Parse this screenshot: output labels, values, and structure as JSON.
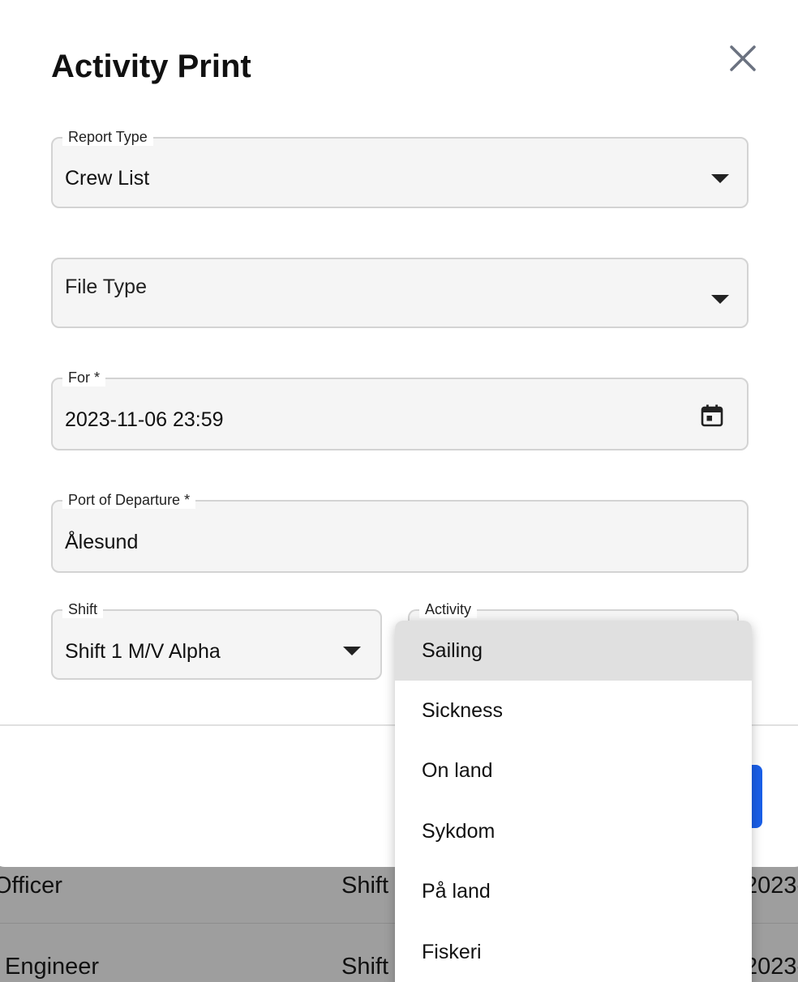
{
  "dialog": {
    "title": "Activity Print",
    "close_icon": "close-icon"
  },
  "form": {
    "report_type": {
      "label": "Report Type",
      "value": "Crew List"
    },
    "file_type": {
      "placeholder": "File Type"
    },
    "for": {
      "label": "For *",
      "value": "2023-11-06 23:59",
      "icon": "calendar-icon"
    },
    "port_of_departure": {
      "label": "Port of Departure *",
      "value": "Ålesund"
    },
    "shift": {
      "label": "Shift",
      "value": "Shift 1 M/V Alpha"
    },
    "activity": {
      "label": "Activity"
    }
  },
  "activity_menu": {
    "items": [
      {
        "label": "Sailing",
        "selected": true
      },
      {
        "label": "Sickness",
        "selected": false
      },
      {
        "label": "On land",
        "selected": false
      },
      {
        "label": "Sykdom",
        "selected": false
      },
      {
        "label": "På land",
        "selected": false
      },
      {
        "label": "Fiskeri",
        "selected": false
      }
    ]
  },
  "background_table": {
    "rows": [
      {
        "role": "Officer",
        "shift": "Shift",
        "date": "2023-"
      },
      {
        "role": "Engineer",
        "shift": "Shift",
        "date": "2023-"
      }
    ]
  },
  "colors": {
    "primary": "#1a5fe8",
    "scrim": "#9e9e9e",
    "field_bg": "#f5f5f5",
    "selected_item": "#e0e0e0"
  }
}
